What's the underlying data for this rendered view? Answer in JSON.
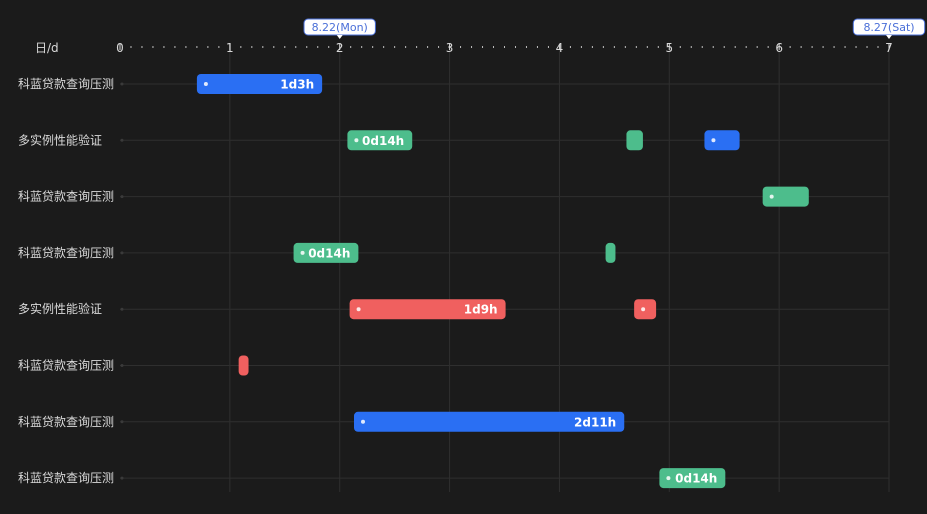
{
  "chart_data": {
    "type": "gantt",
    "x_unit_label": "日/d",
    "xlim": [
      0,
      7
    ],
    "x_ticks": [
      "0",
      "1",
      "2",
      "3",
      "4",
      "5",
      "6",
      "7"
    ],
    "x_markers": [
      {
        "x": 2,
        "label": "8.22(Mon)"
      },
      {
        "x": 7,
        "label": "8.27(Sat)"
      }
    ],
    "colors": {
      "blue": "#2a6ff3",
      "green": "#4dbd8c",
      "red": "#f0605f",
      "background": "#1b1b1b",
      "grid": "#2f2f2f"
    },
    "rows": [
      {
        "label": "科蓝贷款查询压测",
        "bars": [
          {
            "start": 0.7,
            "end": 1.84,
            "color": "blue",
            "text": "1d3h",
            "dot": true
          }
        ]
      },
      {
        "label": "多实例性能验证",
        "bars": [
          {
            "start": 2.07,
            "end": 2.66,
            "color": "green",
            "text": "0d14h",
            "dot": true
          },
          {
            "start": 4.61,
            "end": 4.76,
            "color": "green",
            "text": "",
            "dot": false
          },
          {
            "start": 5.32,
            "end": 5.64,
            "color": "blue",
            "text": "",
            "dot": true
          }
        ]
      },
      {
        "label": "科蓝贷款查询压测",
        "bars": [
          {
            "start": 5.85,
            "end": 6.27,
            "color": "green",
            "text": "",
            "dot": true
          }
        ]
      },
      {
        "label": "科蓝贷款查询压测",
        "bars": [
          {
            "start": 1.58,
            "end": 2.17,
            "color": "green",
            "text": "0d14h",
            "dot": true
          },
          {
            "start": 4.42,
            "end": 4.51,
            "color": "green",
            "text": "",
            "dot": false
          }
        ]
      },
      {
        "label": "多实例性能验证",
        "bars": [
          {
            "start": 2.09,
            "end": 3.51,
            "color": "red",
            "text": "1d9h",
            "dot": true
          },
          {
            "start": 4.68,
            "end": 4.88,
            "color": "red",
            "text": "",
            "dot": true
          }
        ]
      },
      {
        "label": "科蓝贷款查询压测",
        "bars": [
          {
            "start": 1.08,
            "end": 1.17,
            "color": "red",
            "text": "",
            "dot": false
          }
        ]
      },
      {
        "label": "科蓝贷款查询压测",
        "bars": [
          {
            "start": 2.13,
            "end": 4.59,
            "color": "blue",
            "text": "2d11h",
            "dot": true
          }
        ]
      },
      {
        "label": "科蓝贷款查询压测",
        "bars": [
          {
            "start": 4.91,
            "end": 5.51,
            "color": "green",
            "text": "0d14h",
            "dot": true
          }
        ]
      }
    ]
  }
}
